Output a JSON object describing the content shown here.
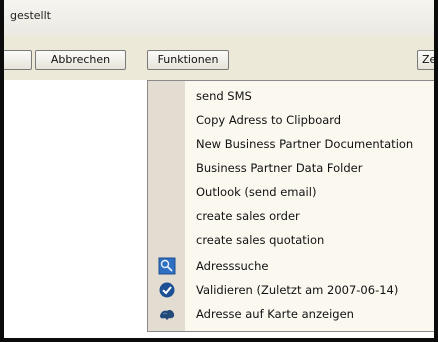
{
  "status": {
    "text": "gestellt"
  },
  "toolbar": {
    "cancel_label": "Abbrechen",
    "functions_label": "Funktionen",
    "partial_right_label": "Ze"
  },
  "menu": {
    "items": [
      {
        "label": "send SMS"
      },
      {
        "label": "Copy Adress to Clipboard"
      },
      {
        "label": "New Business Partner Documentation"
      },
      {
        "label": "Business Partner Data Folder"
      },
      {
        "label": "Outlook (send email)"
      },
      {
        "label": "create sales order"
      },
      {
        "label": "create sales quotation"
      },
      {
        "label": "Adresssuche",
        "icon": "address-search-icon"
      },
      {
        "label": "Validieren (Zuletzt am 2007-06-14)",
        "icon": "validate-check-icon"
      },
      {
        "label": "Adresse auf Karte anzeigen",
        "icon": "map-icon"
      }
    ]
  }
}
